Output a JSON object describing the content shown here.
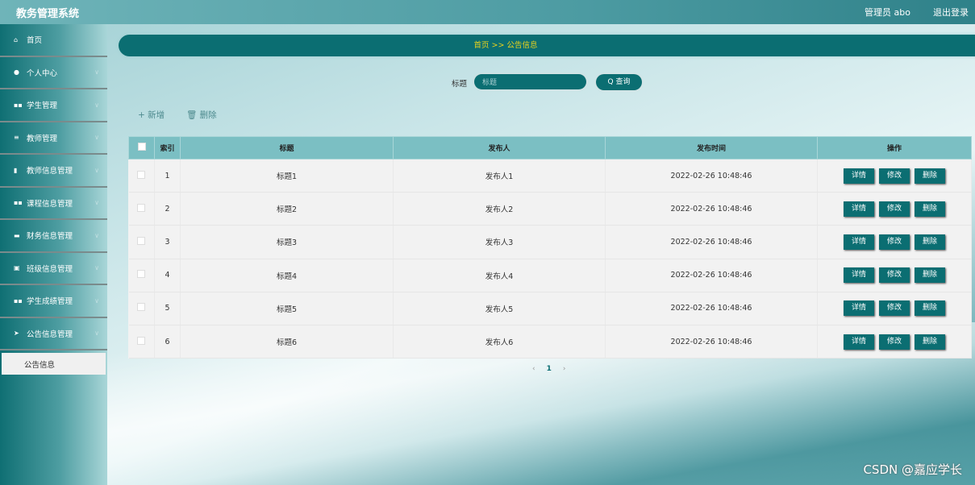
{
  "header": {
    "title": "教务管理系统",
    "user": "管理员 abo",
    "logout": "退出登录"
  },
  "sidebar": {
    "items": [
      {
        "label": "首页",
        "icon": "⌂",
        "chev": false
      },
      {
        "label": "个人中心",
        "icon": "●",
        "chev": true
      },
      {
        "label": "学生管理",
        "icon": "▪▪",
        "chev": true
      },
      {
        "label": "教师管理",
        "icon": "≡",
        "chev": true
      },
      {
        "label": "教师信息管理",
        "icon": "▮",
        "chev": true
      },
      {
        "label": "课程信息管理",
        "icon": "▪▪",
        "chev": true
      },
      {
        "label": "财务信息管理",
        "icon": "▬",
        "chev": true
      },
      {
        "label": "班级信息管理",
        "icon": "▣",
        "chev": true
      },
      {
        "label": "学生成绩管理",
        "icon": "▪▪",
        "chev": true
      },
      {
        "label": "公告信息管理",
        "icon": "➤",
        "chev": true
      }
    ],
    "submenu": "公告信息"
  },
  "breadcrumb": "首页  >>  公告信息",
  "search": {
    "label": "标题",
    "placeholder": "标题",
    "button": "Q 查询"
  },
  "actions": {
    "add": "+ 新增",
    "delete": "🗑 删除"
  },
  "table": {
    "headers": [
      "索引",
      "标题",
      "发布人",
      "发布时间",
      "操作"
    ],
    "rows": [
      [
        "1",
        "标题1",
        "发布人1",
        "2022-02-26 10:48:46"
      ],
      [
        "2",
        "标题2",
        "发布人2",
        "2022-02-26 10:48:46"
      ],
      [
        "3",
        "标题3",
        "发布人3",
        "2022-02-26 10:48:46"
      ],
      [
        "4",
        "标题4",
        "发布人4",
        "2022-02-26 10:48:46"
      ],
      [
        "5",
        "标题5",
        "发布人5",
        "2022-02-26 10:48:46"
      ],
      [
        "6",
        "标题6",
        "发布人6",
        "2022-02-26 10:48:46"
      ]
    ],
    "ops": [
      "详情",
      "修改",
      "删除"
    ]
  },
  "pager": {
    "prev": "‹",
    "page": "1",
    "next": "›"
  },
  "watermark": "CSDN @嘉应学长"
}
